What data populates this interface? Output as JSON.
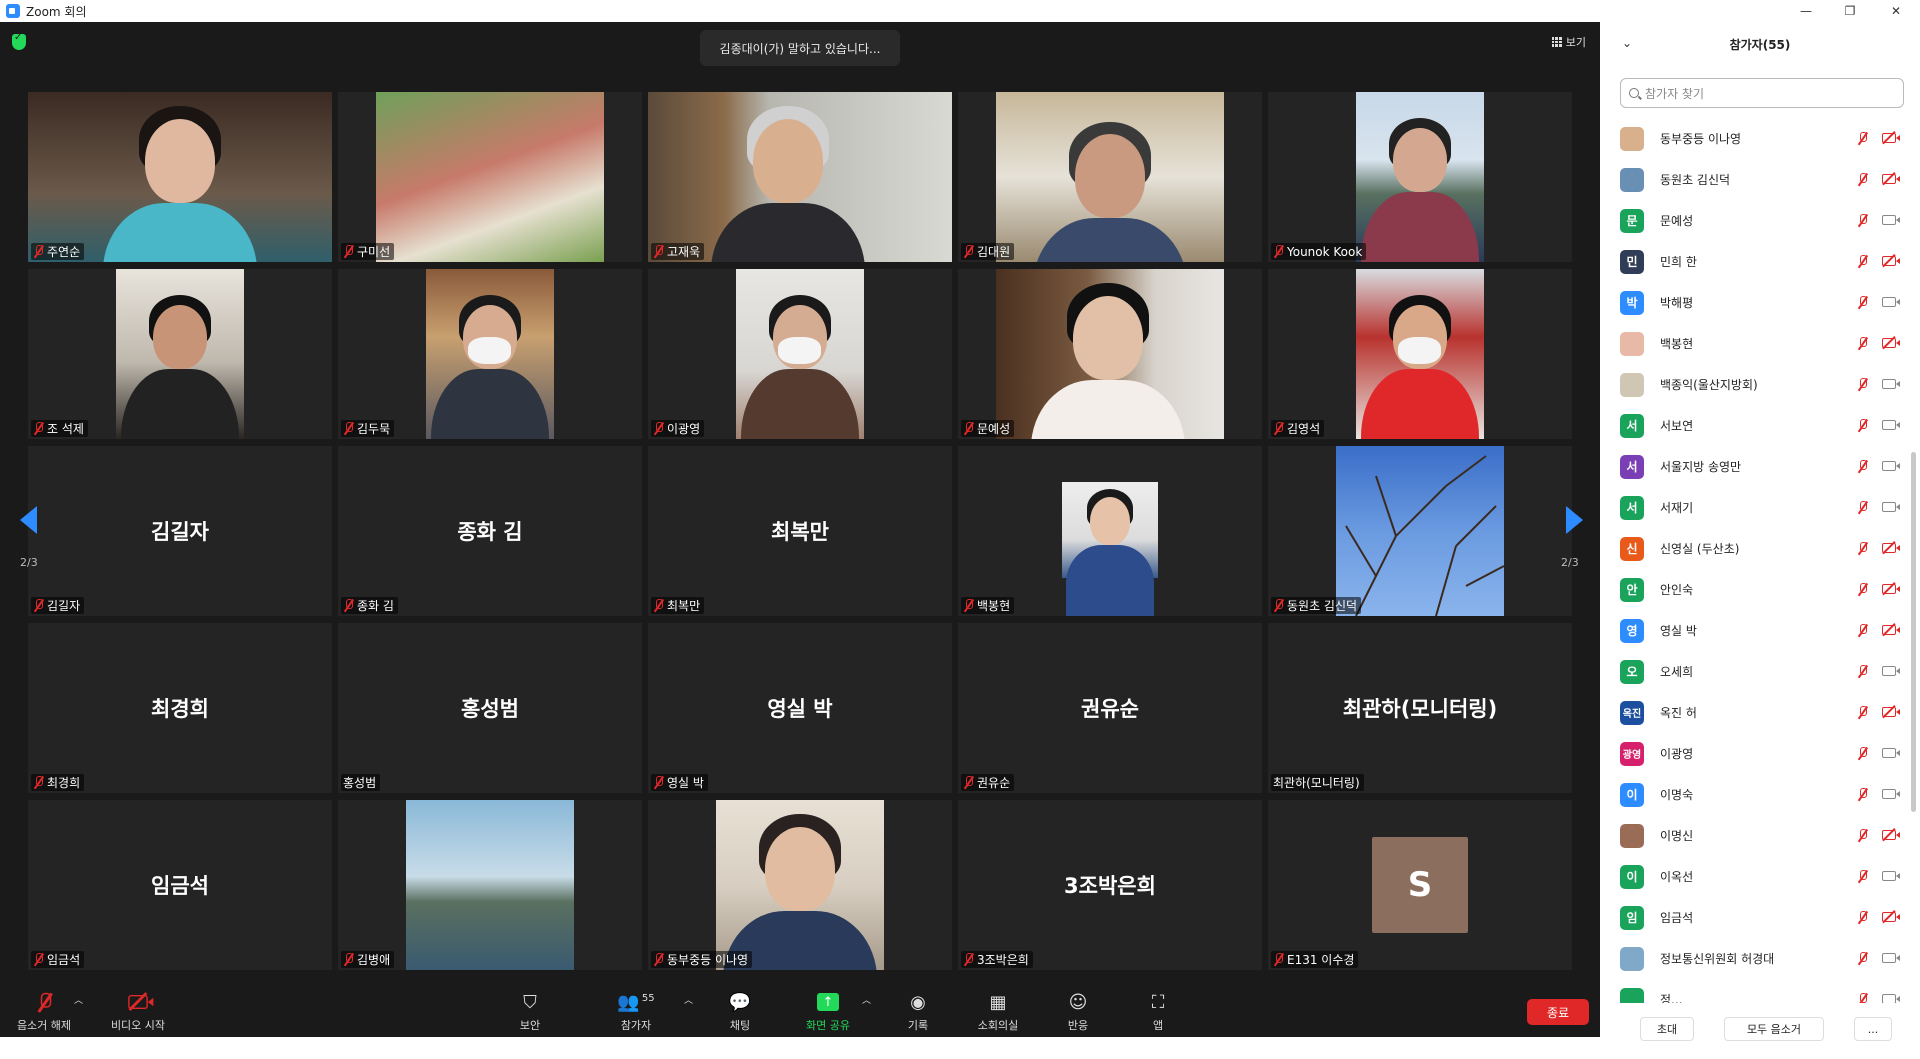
{
  "titlebar": {
    "title": "Zoom 회의",
    "min": "—",
    "restore": "❐",
    "close": "✕"
  },
  "meeting": {
    "speaking": "김종대이(가) 말하고 있습니다...",
    "view_label": "보기",
    "page_left": "2/3",
    "page_right": "2/3"
  },
  "tiles": [
    {
      "label": "주연순",
      "big": ""
    },
    {
      "label": "구미선",
      "big": ""
    },
    {
      "label": "고재욱",
      "big": ""
    },
    {
      "label": "김대원",
      "big": ""
    },
    {
      "label": "Younok Kook",
      "big": ""
    },
    {
      "label": "조 석제",
      "big": ""
    },
    {
      "label": "김두묵",
      "big": ""
    },
    {
      "label": "이광영",
      "big": ""
    },
    {
      "label": "문예성",
      "big": ""
    },
    {
      "label": "김영석",
      "big": ""
    },
    {
      "label": "김길자",
      "big": "김길자"
    },
    {
      "label": "종화 김",
      "big": "종화 김"
    },
    {
      "label": "최복만",
      "big": "최복만"
    },
    {
      "label": "백봉현",
      "big": ""
    },
    {
      "label": "동원초 김신덕",
      "big": ""
    },
    {
      "label": "최경희",
      "big": "최경희"
    },
    {
      "label": "홍성범",
      "big": "홍성범"
    },
    {
      "label": "영실 박",
      "big": "영실 박"
    },
    {
      "label": "권유순",
      "big": "권유순"
    },
    {
      "label": "최관하(모니터링)",
      "big": "최관하(모니터링)"
    },
    {
      "label": "임금석",
      "big": "임금석"
    },
    {
      "label": "김병애",
      "big": ""
    },
    {
      "label": "동부중등 이나영",
      "big": ""
    },
    {
      "label": "3조박은희",
      "big": "3조박은희"
    },
    {
      "label": "E131 이수경",
      "big": "S"
    }
  ],
  "toolbar": {
    "unmute": "음소거 해제",
    "video": "비디오 시작",
    "security": "보안",
    "participants": "참가자",
    "participants_count": "55",
    "chat": "채팅",
    "share": "화면 공유",
    "record": "기록",
    "breakout": "소회의실",
    "reactions": "반응",
    "apps": "앱",
    "end": "종료"
  },
  "panel": {
    "title": "참가자(55)",
    "search_placeholder": "참가자 찾기",
    "invite": "초대",
    "mute_all": "모두 음소거",
    "more": "...",
    "participants": [
      {
        "name": "동부중등 이나영",
        "initial": "",
        "color": "#d9b08c",
        "cam_off": true
      },
      {
        "name": "동원초 김신덕",
        "initial": "",
        "color": "#6a8fb5",
        "cam_off": true
      },
      {
        "name": "문예성",
        "initial": "문",
        "color": "#1aa35a",
        "cam_off": false
      },
      {
        "name": "민희 한",
        "initial": "민",
        "color": "#2f3e56",
        "cam_off": true
      },
      {
        "name": "박해평",
        "initial": "박",
        "color": "#2d8cff",
        "cam_off": false
      },
      {
        "name": "백봉현",
        "initial": "",
        "color": "#e9b9a8",
        "cam_off": true
      },
      {
        "name": "백종익(울산지방회)",
        "initial": "",
        "color": "#cfc6b4",
        "cam_off": false
      },
      {
        "name": "서보연",
        "initial": "서",
        "color": "#1aa35a",
        "cam_off": false
      },
      {
        "name": "서울지방 송영만",
        "initial": "서",
        "color": "#7b3fb5",
        "cam_off": false
      },
      {
        "name": "서재기",
        "initial": "서",
        "color": "#1aa35a",
        "cam_off": false
      },
      {
        "name": "신영실 (두산초)",
        "initial": "신",
        "color": "#e8591a",
        "cam_off": true
      },
      {
        "name": "안인숙",
        "initial": "안",
        "color": "#1aa35a",
        "cam_off": true
      },
      {
        "name": "영실 박",
        "initial": "영",
        "color": "#2d8cff",
        "cam_off": true
      },
      {
        "name": "오세희",
        "initial": "오",
        "color": "#1aa35a",
        "cam_off": false
      },
      {
        "name": "옥진 허",
        "initial": "옥진",
        "color": "#1c4fa0",
        "cam_off": true
      },
      {
        "name": "이광영",
        "initial": "광영",
        "color": "#d6206b",
        "cam_off": false
      },
      {
        "name": "이명숙",
        "initial": "이",
        "color": "#2d8cff",
        "cam_off": false
      },
      {
        "name": "이명신",
        "initial": "",
        "color": "#9a6b55",
        "cam_off": true
      },
      {
        "name": "이옥선",
        "initial": "이",
        "color": "#1aa35a",
        "cam_off": false
      },
      {
        "name": "임금석",
        "initial": "임",
        "color": "#1aa35a",
        "cam_off": true
      },
      {
        "name": "정보통신위원회 허경대",
        "initial": "",
        "color": "#7fa8c9",
        "cam_off": false
      },
      {
        "name": "정...",
        "initial": "",
        "color": "#1aa35a",
        "cam_off": false
      }
    ]
  }
}
